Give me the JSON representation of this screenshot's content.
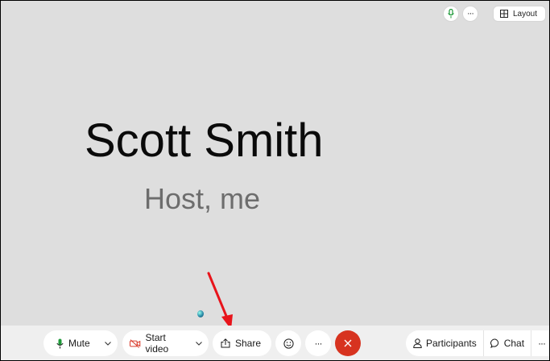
{
  "stage": {
    "participant_name": "Scott Smith",
    "participant_role": "Host, me"
  },
  "top_controls": {
    "mic_status_icon": "microphone-icon",
    "more_icon": "ellipsis-icon",
    "layout_label": "Layout",
    "layout_icon": "grid-icon"
  },
  "toolbar": {
    "mute_label": "Mute",
    "start_video_label": "Start video",
    "share_label": "Share",
    "reactions_icon": "emoji-icon",
    "more_icon": "ellipsis-icon",
    "end_call_icon": "close-icon",
    "participants_label": "Participants",
    "chat_label": "Chat",
    "overflow_icon": "ellipsis-icon"
  },
  "colors": {
    "stage_bg": "#dedede",
    "mic_green": "#1f9a3a",
    "video_red": "#d93b2b",
    "end_call_red": "#d7331f",
    "annotation_arrow": "#e8141b"
  }
}
